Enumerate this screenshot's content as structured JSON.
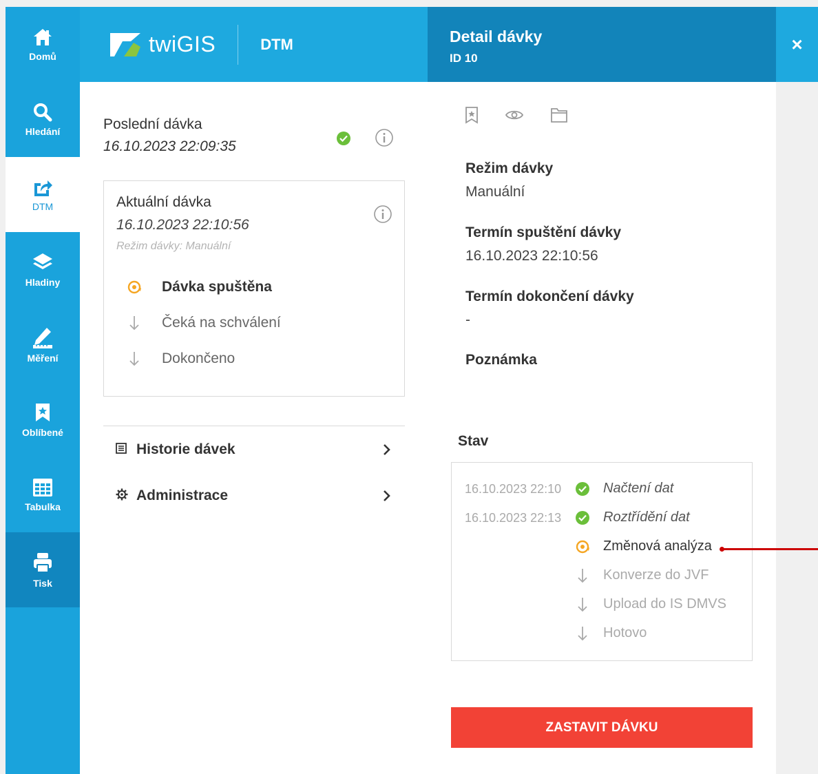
{
  "nav": {
    "items": [
      {
        "label": "Domů",
        "icon": "home-icon"
      },
      {
        "label": "Hledání",
        "icon": "search-icon"
      },
      {
        "label": "DTM",
        "icon": "share-icon"
      },
      {
        "label": "Hladiny",
        "icon": "layers-icon"
      },
      {
        "label": "Měření",
        "icon": "ruler-pencil-icon"
      },
      {
        "label": "Oblíbené",
        "icon": "bookmark-star-icon"
      },
      {
        "label": "Tabulka",
        "icon": "table-icon"
      },
      {
        "label": "Tisk",
        "icon": "printer-icon"
      }
    ]
  },
  "header": {
    "logo_text": "twiGIS",
    "section": "DTM"
  },
  "detail_header": {
    "title": "Detail dávky",
    "id": "ID 10",
    "close": "×"
  },
  "last_batch": {
    "title": "Poslední dávka",
    "date": "16.10.2023 22:09:35"
  },
  "current_batch": {
    "title": "Aktuální dávka",
    "date": "16.10.2023 22:10:56",
    "mode": "Režim dávky: Manuální",
    "steps": [
      {
        "label": "Dávka spuštěna",
        "state": "active"
      },
      {
        "label": "Čeká na schválení",
        "state": "pending"
      },
      {
        "label": "Dokončeno",
        "state": "pending"
      }
    ]
  },
  "menu": {
    "history": "Historie dávek",
    "admin": "Administrace"
  },
  "detail": {
    "mode_label": "Režim dávky",
    "mode_value": "Manuální",
    "start_label": "Termín spuštění dávky",
    "start_value": "16.10.2023 22:10:56",
    "end_label": "Termín dokončení dávky",
    "end_value": "-",
    "note_label": "Poznámka",
    "status_label": "Stav",
    "status_rows": [
      {
        "time": "16.10.2023 22:10",
        "label": "Načtení dat",
        "state": "done"
      },
      {
        "time": "16.10.2023 22:13",
        "label": "Roztřídění dat",
        "state": "done"
      },
      {
        "time": "",
        "label": "Změnová analýza",
        "state": "active"
      },
      {
        "time": "",
        "label": "Konverze do JVF",
        "state": "pending"
      },
      {
        "time": "",
        "label": "Upload do IS DMVS",
        "state": "pending"
      },
      {
        "time": "",
        "label": "Hotovo",
        "state": "pending"
      }
    ],
    "stop_button": "ZASTAVIT DÁVKU"
  },
  "colors": {
    "rail": "#1aa3dc",
    "header": "#1ea9df",
    "detail_header": "#1284ba",
    "ok": "#6bbf3a",
    "active": "#f5a623",
    "stop": "#f24236"
  }
}
